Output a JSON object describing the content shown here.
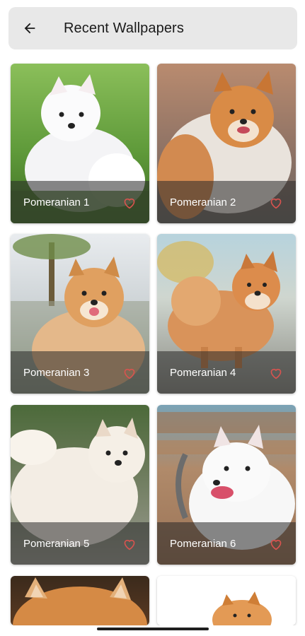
{
  "header": {
    "title": "Recent Wallpapers",
    "back_icon": "arrow-left-icon"
  },
  "wallpapers": [
    {
      "name": "Pomeranian 1",
      "favorite_icon": "heart-outline-icon"
    },
    {
      "name": "Pomeranian 2",
      "favorite_icon": "heart-outline-icon"
    },
    {
      "name": "Pomeranian 3",
      "favorite_icon": "heart-outline-icon"
    },
    {
      "name": "Pomeranian 4",
      "favorite_icon": "heart-outline-icon"
    },
    {
      "name": "Pomeranian 5",
      "favorite_icon": "heart-outline-icon"
    },
    {
      "name": "Pomeranian 6",
      "favorite_icon": "heart-outline-icon"
    },
    {
      "name": "",
      "favorite_icon": ""
    },
    {
      "name": "",
      "favorite_icon": ""
    }
  ],
  "colors": {
    "header_bg": "#e8e8e8",
    "heart": "#d9534f",
    "label": "#ffffff"
  }
}
